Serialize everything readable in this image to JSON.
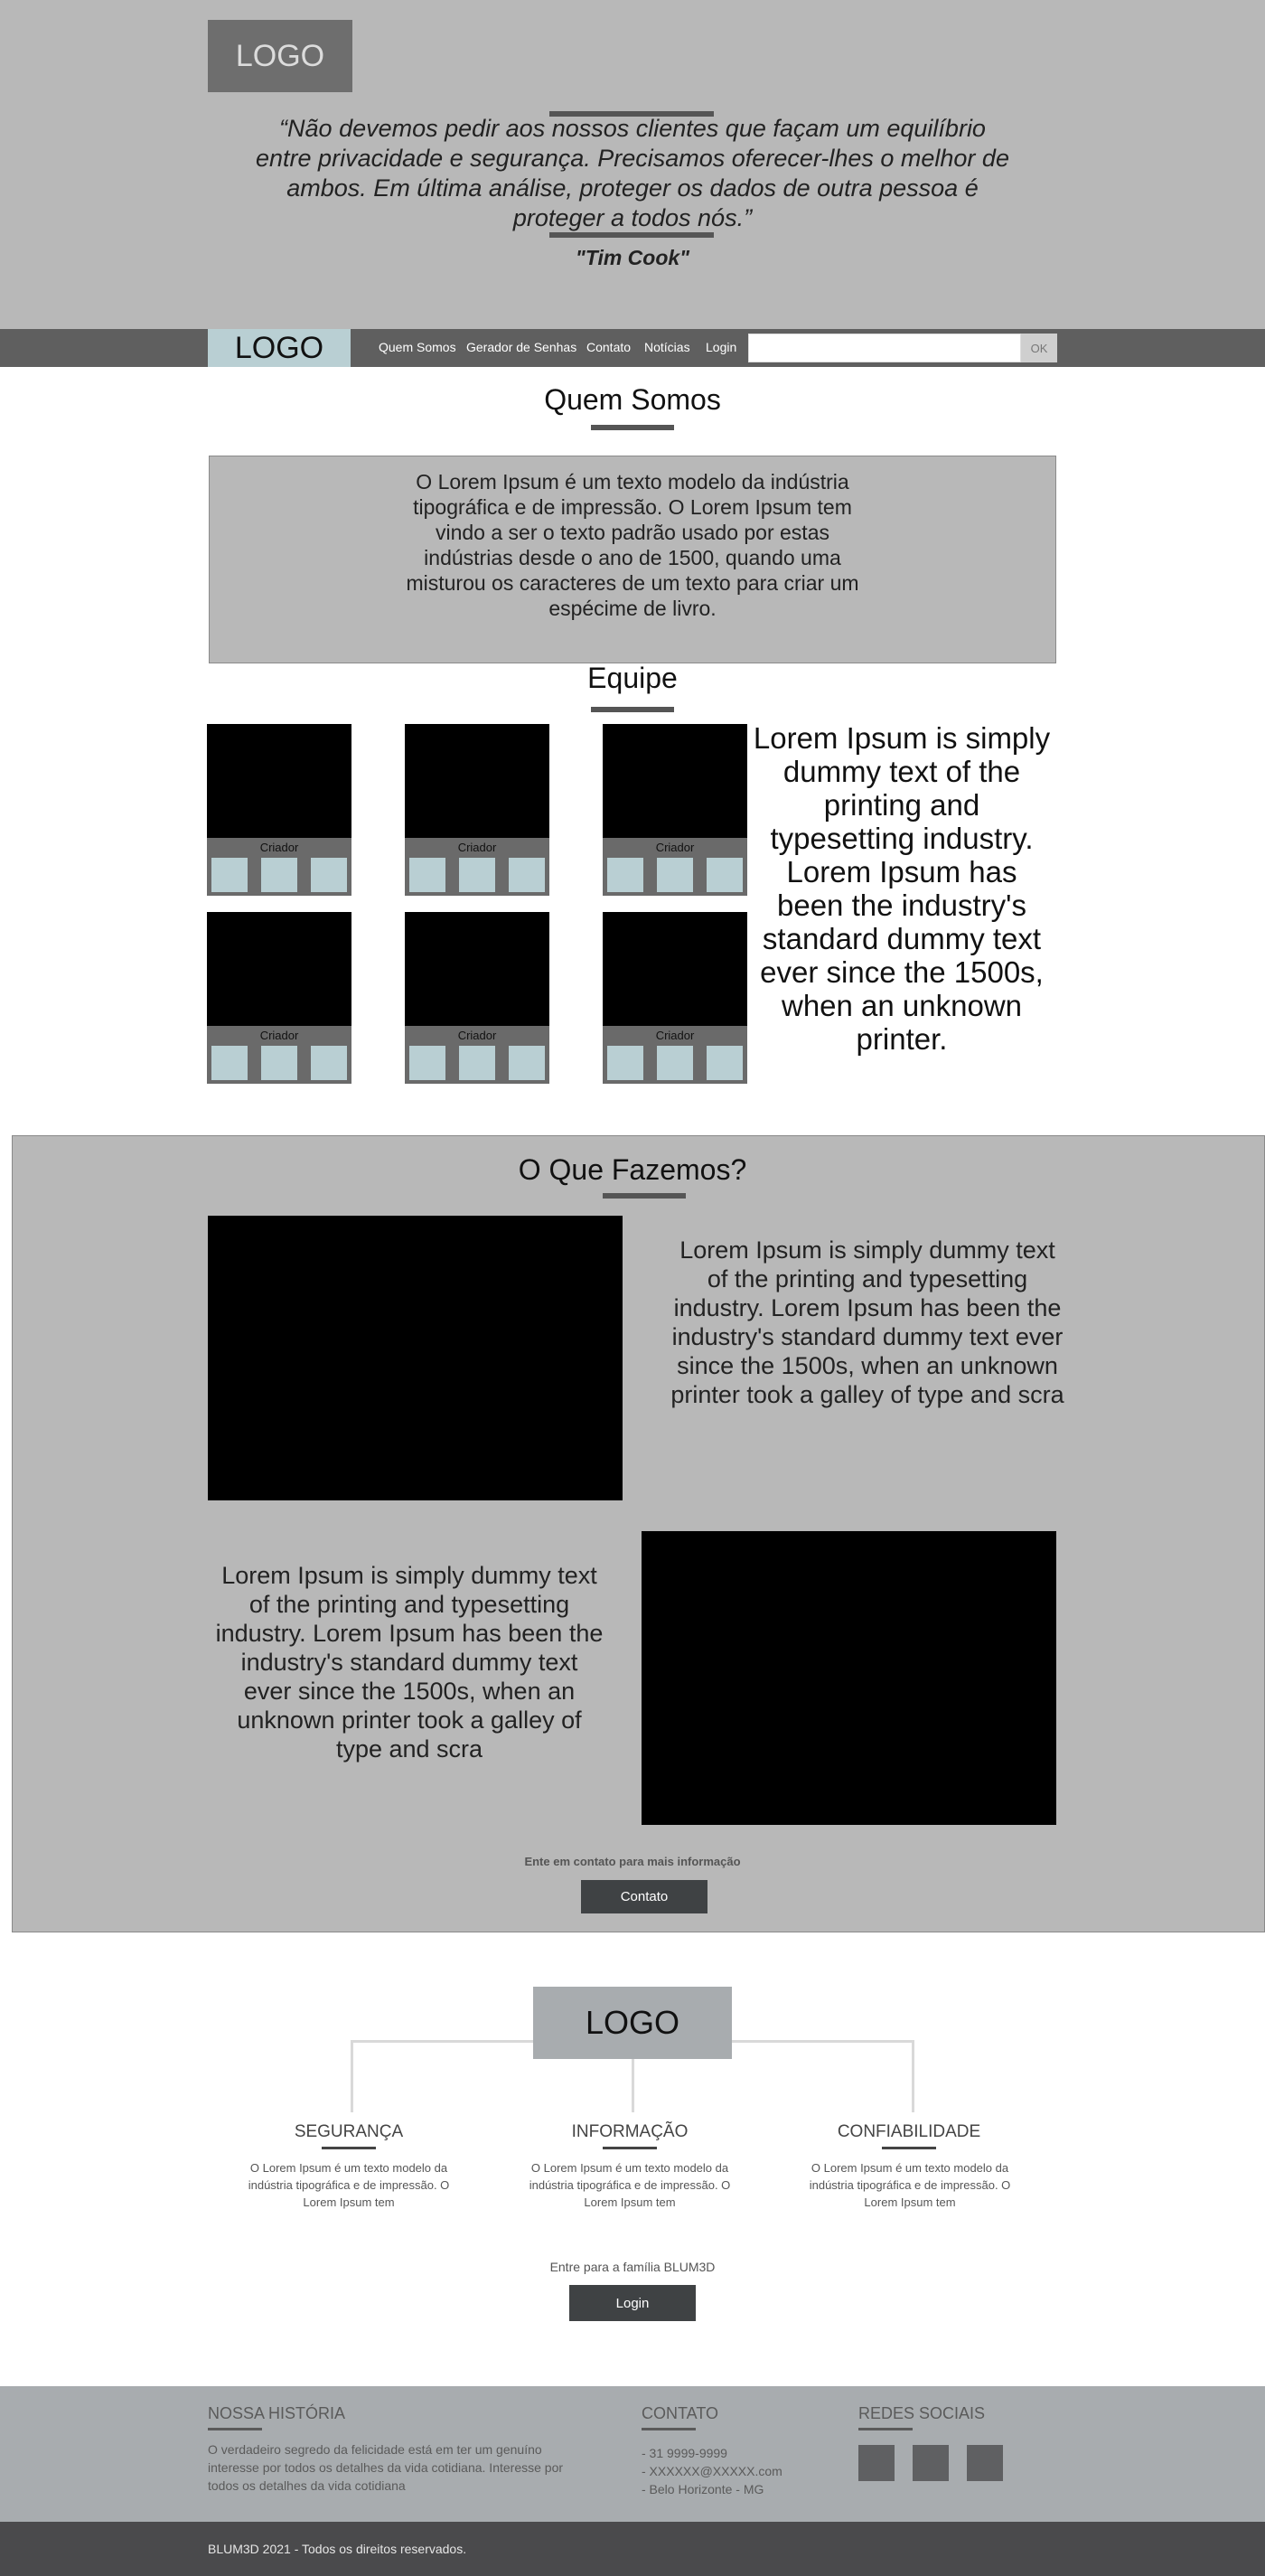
{
  "hero": {
    "logo": "LOGO",
    "quote": "“Não devemos pedir aos nossos clientes que façam um equilíbrio entre privacidade e segurança. Precisamos oferecer-lhes o melhor de ambos. Em última análise, proteger os dados de outra pessoa é proteger a todos nós.”",
    "author": "\"Tim Cook\""
  },
  "nav": {
    "logo": "LOGO",
    "links": [
      "Quem Somos",
      "Gerador de Senhas",
      "Contato",
      "Notícias",
      "Login"
    ],
    "search_value": "",
    "ok_label": "OK"
  },
  "about": {
    "title": "Quem Somos",
    "text": "O Lorem Ipsum é um texto modelo da indústria tipográfica e de impressão. O Lorem Ipsum tem vindo a ser o texto padrão usado por estas indústrias desde o ano de 1500, quando uma misturou os caracteres de um texto para criar um espécime de livro."
  },
  "team": {
    "title": "Equipe",
    "members": [
      {
        "label": "Criador"
      },
      {
        "label": "Criador"
      },
      {
        "label": "Criador"
      },
      {
        "label": "Criador"
      },
      {
        "label": "Criador"
      },
      {
        "label": "Criador"
      }
    ],
    "text": "Lorem Ipsum is simply dummy text of the printing and typesetting industry. Lorem Ipsum has been the industry's standard dummy text ever since the 1500s, when an unknown printer."
  },
  "what": {
    "title": "O Que Fazemos?",
    "text1": "Lorem Ipsum is simply dummy text of the printing and typesetting industry. Lorem Ipsum has been the industry's standard dummy text ever since the 1500s, when an unknown printer took a galley of type and scra",
    "text2": "Lorem Ipsum is simply dummy text of the printing and typesetting industry. Lorem Ipsum has been the industry's standard dummy text ever since the 1500s, when an unknown printer took a galley of type and scra",
    "cta_text": "Ente em contato para mais informação",
    "cta_button": "Contato"
  },
  "values": {
    "logo": "LOGO",
    "items": [
      {
        "title": "SEGURANÇA",
        "text": "O Lorem Ipsum é um texto modelo da indústria tipográfica e de impressão. O Lorem Ipsum tem"
      },
      {
        "title": "INFORMAÇÃO",
        "text": "O Lorem Ipsum é um texto modelo da indústria tipográfica e de impressão. O Lorem Ipsum tem"
      },
      {
        "title": "CONFIABILIDADE",
        "text": "O Lorem Ipsum é um texto modelo da indústria tipográfica e de impressão. O Lorem Ipsum tem"
      }
    ],
    "join_text": "Entre para a família BLUM3D",
    "join_button": "Login"
  },
  "footer": {
    "history_title": "NOSSA HISTÓRIA",
    "history_text": "O verdadeiro segredo da felicidade está em ter um genuíno interesse por todos os detalhes da vida cotidiana. Interesse por todos os detalhes da vida cotidiana",
    "contact_title": "CONTATO",
    "contact_phone": "- 31 9999-9999",
    "contact_email": "- XXXXXX@XXXXX.com",
    "contact_city": "- Belo Horizonte - MG",
    "social_title": "REDES SOCIAIS",
    "copyright": "BLUM3D 2021 - Todos os direitos reservados."
  }
}
